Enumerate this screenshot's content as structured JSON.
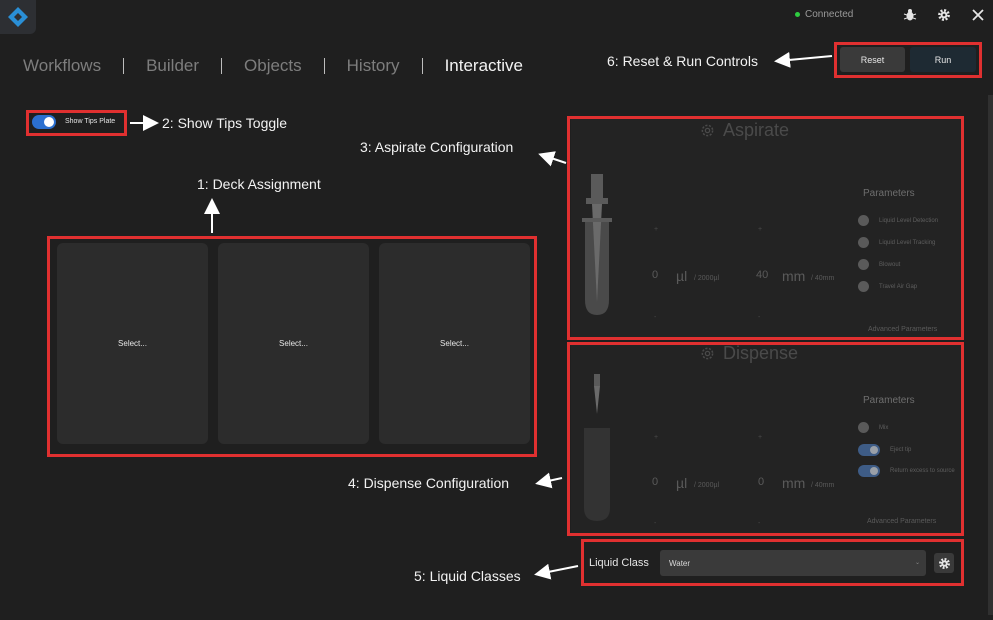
{
  "titlebar": {
    "status_text": "Connected"
  },
  "nav": {
    "tabs": [
      {
        "label": "Workflows"
      },
      {
        "label": "Builder"
      },
      {
        "label": "Objects"
      },
      {
        "label": "History"
      },
      {
        "label": "Interactive"
      }
    ]
  },
  "controls": {
    "reset_label": "Reset",
    "run_label": "Run"
  },
  "tips_toggle": {
    "label": "Show Tips Plate",
    "on": true
  },
  "deck": {
    "slots": [
      {
        "label": "Select..."
      },
      {
        "label": "Select..."
      },
      {
        "label": "Select..."
      }
    ]
  },
  "aspirate": {
    "title": "Aspirate",
    "volume_value": "0",
    "volume_unit": "µl",
    "volume_max": "/ 2000µl",
    "height_value": "40",
    "height_unit": "mm",
    "height_max": "/ 40mm",
    "plus": "+",
    "minus": "-",
    "params_title": "Parameters",
    "params": [
      {
        "label": "Liquid Level Detection"
      },
      {
        "label": "Liquid Level Tracking"
      },
      {
        "label": "Blowout"
      },
      {
        "label": "Travel Air Gap"
      }
    ],
    "advanced_label": "Advanced Parameters"
  },
  "dispense": {
    "title": "Dispense",
    "volume_value": "0",
    "volume_unit": "µl",
    "volume_max": "/ 2000µl",
    "height_value": "0",
    "height_unit": "mm",
    "height_max": "/ 40mm",
    "plus": "+",
    "minus": "-",
    "params_title": "Parameters",
    "params": [
      {
        "label": "Mix",
        "on": false
      },
      {
        "label": "Eject tip",
        "on": true
      },
      {
        "label": "Return excess to source",
        "on": true
      }
    ],
    "advanced_label": "Advanced Parameters"
  },
  "liquid_class": {
    "label": "Liquid Class",
    "value": "Water",
    "chevron": "⌄"
  },
  "annotations": {
    "a1": "1: Deck Assignment",
    "a2": "2: Show Tips Toggle",
    "a3": "3: Aspirate Configuration",
    "a4": "4: Dispense Configuration",
    "a5": "5: Liquid Classes",
    "a6": "6: Reset & Run Controls"
  },
  "colors": {
    "background": "#1f1f1f",
    "highlight": "#e03030",
    "accent": "#2b6fcf",
    "status": "#2ecc40"
  }
}
